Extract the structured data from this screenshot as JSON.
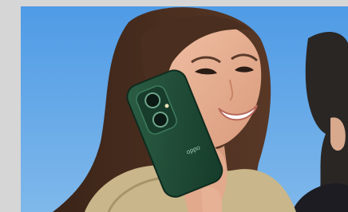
{
  "image": {
    "subject": "woman-smiling-holding-phone",
    "background_color": "#5ea3e3",
    "phone_color": "#1f4a35",
    "phone_brand_text": "oppo"
  }
}
